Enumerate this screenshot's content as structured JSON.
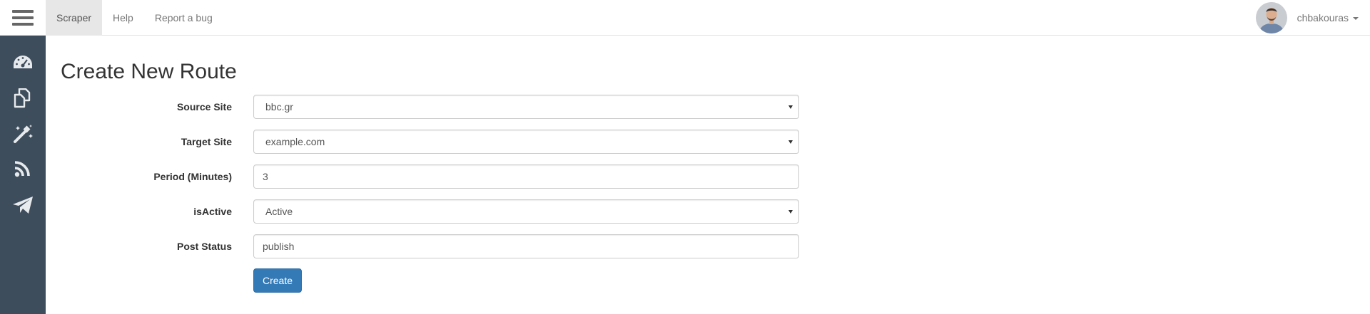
{
  "navbar": {
    "menu_icon": "hamburger-menu-icon",
    "links": [
      "Scraper",
      "Help",
      "Report a bug"
    ],
    "user": {
      "name": "chbakouras",
      "avatar_icon": "user-avatar"
    }
  },
  "sidebar": {
    "icons": [
      "dashboard-icon",
      "copy-icon",
      "magic-wand-icon",
      "rss-icon",
      "paper-plane-icon"
    ]
  },
  "page": {
    "title": "Create New Route"
  },
  "form": {
    "source_site": {
      "label": "Source Site",
      "value": "bbc.gr"
    },
    "target_site": {
      "label": "Target Site",
      "value": "example.com"
    },
    "period": {
      "label": "Period (Minutes)",
      "value": "3"
    },
    "is_active": {
      "label": "isActive",
      "value": "Active"
    },
    "post_status": {
      "label": "Post Status",
      "value": "publish"
    },
    "submit_label": "Create"
  },
  "colors": {
    "sidebar_bg": "#3e4d5c",
    "primary_button": "#337ab7",
    "active_nav_bg": "#e7e7e7"
  }
}
